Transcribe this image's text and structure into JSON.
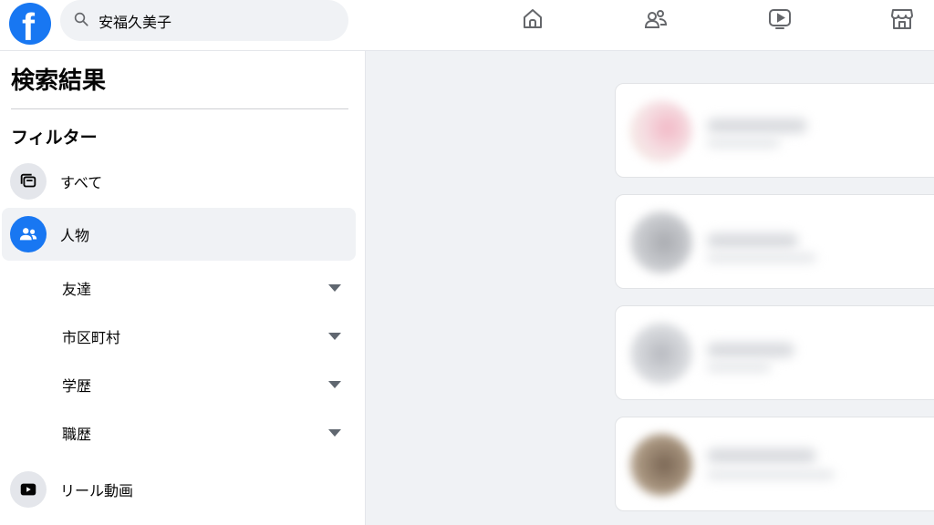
{
  "topbar": {
    "search": {
      "value": "安福久美子",
      "icon": "search-icon"
    },
    "nav": [
      {
        "name": "home",
        "icon": "home-icon"
      },
      {
        "name": "friends",
        "icon": "friends-icon"
      },
      {
        "name": "watch",
        "icon": "video-icon"
      },
      {
        "name": "marketplace",
        "icon": "store-icon"
      }
    ]
  },
  "sidebar": {
    "title": "検索結果",
    "filters_heading": "フィルター",
    "items": [
      {
        "label": "すべて",
        "icon": "all-results-icon",
        "active": false
      },
      {
        "label": "人物",
        "icon": "people-icon",
        "active": true
      },
      {
        "label": "リール動画",
        "icon": "reels-icon",
        "active": false
      }
    ],
    "subfilters": [
      {
        "label": "友達"
      },
      {
        "label": "市区町村"
      },
      {
        "label": "学歴"
      },
      {
        "label": "職歴"
      }
    ]
  },
  "colors": {
    "brand": "#1877f2",
    "background": "#f0f2f5",
    "surface": "#ffffff"
  }
}
